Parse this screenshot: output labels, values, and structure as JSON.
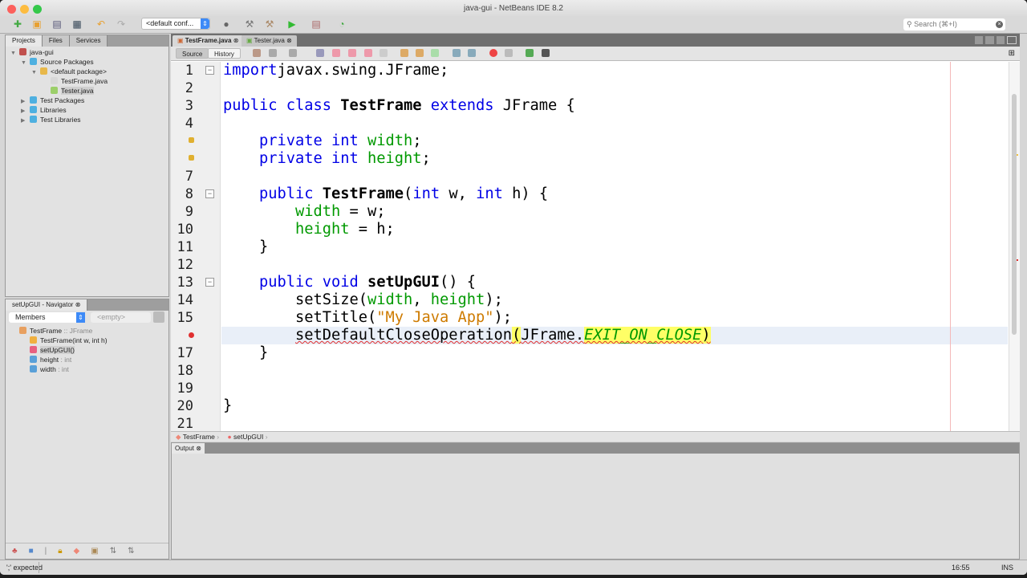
{
  "window": {
    "title": "java-gui - NetBeans IDE 8.2"
  },
  "toolbar": {
    "config": "<default conf...",
    "search_placeholder": "Search (⌘+I)"
  },
  "projects": {
    "tabs": [
      "Projects",
      "Files",
      "Services"
    ],
    "tree": [
      {
        "label": "java-gui",
        "level": 0,
        "icon": "project-icon",
        "color": "#c0504d",
        "arrow": "▼"
      },
      {
        "label": "Source Packages",
        "level": 1,
        "icon": "folder-icon",
        "color": "#4fb0e0",
        "arrow": "▼"
      },
      {
        "label": "<default package>",
        "level": 2,
        "icon": "package-icon",
        "color": "#e8b84a",
        "arrow": "▼"
      },
      {
        "label": "TestFrame.java",
        "level": 3,
        "icon": "java-file-icon",
        "color": "#d8d8d8",
        "arrow": ""
      },
      {
        "label": "Tester.java",
        "level": 3,
        "icon": "java-main-file-icon",
        "color": "#9ccf6a",
        "arrow": "",
        "selected": true
      },
      {
        "label": "Test Packages",
        "level": 1,
        "icon": "folder-icon",
        "color": "#4fb0e0",
        "arrow": "▶"
      },
      {
        "label": "Libraries",
        "level": 1,
        "icon": "library-icon",
        "color": "#4fb0e0",
        "arrow": "▶"
      },
      {
        "label": "Test Libraries",
        "level": 1,
        "icon": "library-icon",
        "color": "#4fb0e0",
        "arrow": "▶"
      }
    ]
  },
  "navigator": {
    "title": "setUpGUI - Navigator",
    "filter": "Members",
    "empty": "<empty>",
    "tree": [
      {
        "label": "TestFrame",
        "type": " :: JFrame",
        "level": 0,
        "icon": "class-icon",
        "color": "#e8a060"
      },
      {
        "label": "TestFrame(int w, int h)",
        "type": "",
        "level": 1,
        "icon": "constructor-icon",
        "color": "#f0b040"
      },
      {
        "label": "setUpGUI()",
        "type": "",
        "level": 1,
        "icon": "method-icon",
        "color": "#e86080",
        "selected": true
      },
      {
        "label": "height",
        "type": " : int",
        "level": 1,
        "icon": "field-icon",
        "color": "#5aa0d8"
      },
      {
        "label": "width",
        "type": " : int",
        "level": 1,
        "icon": "field-icon",
        "color": "#5aa0d8"
      }
    ]
  },
  "editor": {
    "tabs": [
      "TestFrame.java",
      "Tester.java"
    ],
    "source_label": "Source",
    "history_label": "History",
    "lines": [
      {
        "n": "1",
        "t": [
          [
            "kw",
            "import"
          ],
          [
            "",
            "javax.swing.JFrame;"
          ]
        ]
      },
      {
        "n": "2",
        "t": []
      },
      {
        "n": "3",
        "t": [
          [
            "kw",
            "public class "
          ],
          [
            "b",
            "TestFrame"
          ],
          [
            "kw",
            " extends "
          ],
          [
            "",
            "JFrame {"
          ]
        ]
      },
      {
        "n": "4",
        "t": []
      },
      {
        "n": "",
        "t": [
          [
            "",
            "    "
          ],
          [
            "kw",
            "private int "
          ],
          [
            "fld",
            "width"
          ],
          [
            "",
            ";"
          ]
        ]
      },
      {
        "n": "",
        "t": [
          [
            "",
            "    "
          ],
          [
            "kw",
            "private int "
          ],
          [
            "fld",
            "height"
          ],
          [
            "",
            ";"
          ]
        ]
      },
      {
        "n": "7",
        "t": []
      },
      {
        "n": "8",
        "t": [
          [
            "",
            "    "
          ],
          [
            "kw",
            "public "
          ],
          [
            "b",
            "TestFrame"
          ],
          [
            "",
            "("
          ],
          [
            "kw",
            "int"
          ],
          [
            "",
            " w, "
          ],
          [
            "kw",
            "int"
          ],
          [
            "",
            " h) {"
          ]
        ]
      },
      {
        "n": "9",
        "t": [
          [
            "",
            "        "
          ],
          [
            "fld",
            "width"
          ],
          [
            "",
            " = w;"
          ]
        ]
      },
      {
        "n": "10",
        "t": [
          [
            "",
            "        "
          ],
          [
            "fld",
            "height"
          ],
          [
            "",
            " = h;"
          ]
        ]
      },
      {
        "n": "11",
        "t": [
          [
            "",
            "    }"
          ]
        ]
      },
      {
        "n": "12",
        "t": []
      },
      {
        "n": "13",
        "t": [
          [
            "",
            "    "
          ],
          [
            "kw",
            "public void "
          ],
          [
            "b",
            "setUpGUI"
          ],
          [
            "",
            "() {"
          ]
        ]
      },
      {
        "n": "14",
        "t": [
          [
            "",
            "        setSize("
          ],
          [
            "fld",
            "width"
          ],
          [
            "",
            ", "
          ],
          [
            "fld",
            "height"
          ],
          [
            "",
            ");"
          ]
        ]
      },
      {
        "n": "15",
        "t": [
          [
            "",
            "        setTitle("
          ],
          [
            "str",
            "\"My Java App\""
          ],
          [
            "",
            ");"
          ]
        ]
      },
      {
        "n": "",
        "t": [
          [
            "",
            "        "
          ],
          [
            "err",
            "setDefaultCloseOperation"
          ],
          [
            "err hl",
            "("
          ],
          [
            "err",
            "JFrame."
          ],
          [
            "err it hl",
            "EXIT_ON_CLOSE"
          ],
          [
            "err hl",
            ")"
          ]
        ]
      },
      {
        "n": "17",
        "t": [
          [
            "",
            "    }"
          ]
        ]
      },
      {
        "n": "18",
        "t": []
      },
      {
        "n": "19",
        "t": []
      },
      {
        "n": "20",
        "t": [
          [
            "",
            "}"
          ]
        ]
      },
      {
        "n": "21",
        "t": []
      }
    ]
  },
  "breadcrumb": [
    "TestFrame",
    "setUpGUI"
  ],
  "output": {
    "tab": "Output"
  },
  "status": {
    "message": "';' expected",
    "position": "16:55",
    "mode": "INS"
  }
}
